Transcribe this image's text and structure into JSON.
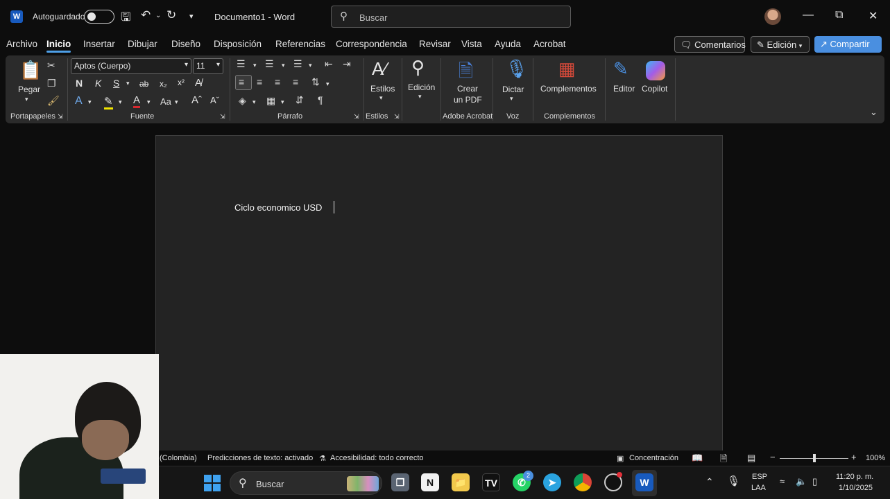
{
  "titlebar": {
    "app_icon": "W",
    "autosave_label": "Autoguardado",
    "doc_title": "Documento1  -  Word",
    "search_placeholder": "Buscar",
    "icons": [
      "save-icon",
      "undo-icon",
      "redo-icon",
      "customize-icon"
    ]
  },
  "menu": {
    "tabs": [
      "Archivo",
      "Inicio",
      "Insertar",
      "Dibujar",
      "Diseño",
      "Disposición",
      "Referencias",
      "Correspondencia",
      "Revisar",
      "Vista",
      "Ayuda",
      "Acrobat"
    ],
    "active_tab": "Inicio",
    "comments_label": "Comentarios",
    "editing_label": "Edición",
    "share_label": "Compartir"
  },
  "ribbon": {
    "paste_label": "Pegar",
    "font_name": "Aptos (Cuerpo)",
    "font_size": "11",
    "bold_glyph": "N",
    "italic_glyph": "K",
    "underline_glyph": "S",
    "styles_label": "Estilos",
    "editing_label": "Edición",
    "create_pdf_line1": "Crear",
    "create_pdf_line2": "un PDF",
    "dictate_label": "Dictar",
    "addins_label": "Complementos",
    "editor_label": "Editor",
    "copilot_label": "Copilot",
    "groups": {
      "clipboard": "Portapapeles",
      "font": "Fuente",
      "paragraph": "Párrafo",
      "styles": "Estilos",
      "acrobat": "Adobe Acrobat",
      "voice": "Voz",
      "addins": "Complementos"
    }
  },
  "document": {
    "text": "Ciclo economico USD"
  },
  "statusbar": {
    "language": "(Colombia)",
    "predictions": "Predicciones de texto: activado",
    "accessibility": "Accesibilidad: todo correcto",
    "focus": "Concentración",
    "zoom": "100%",
    "zoom_level": 1.0
  },
  "taskbar": {
    "search_placeholder": "Buscar",
    "whatsapp_badge": "2",
    "lang_line1": "ESP",
    "lang_line2": "LAA",
    "time": "11:20 p. m.",
    "date": "1/10/2025"
  },
  "colors": {
    "accent": "#4ea0e8",
    "share": "#4a8fe0",
    "word": "#185abd"
  }
}
